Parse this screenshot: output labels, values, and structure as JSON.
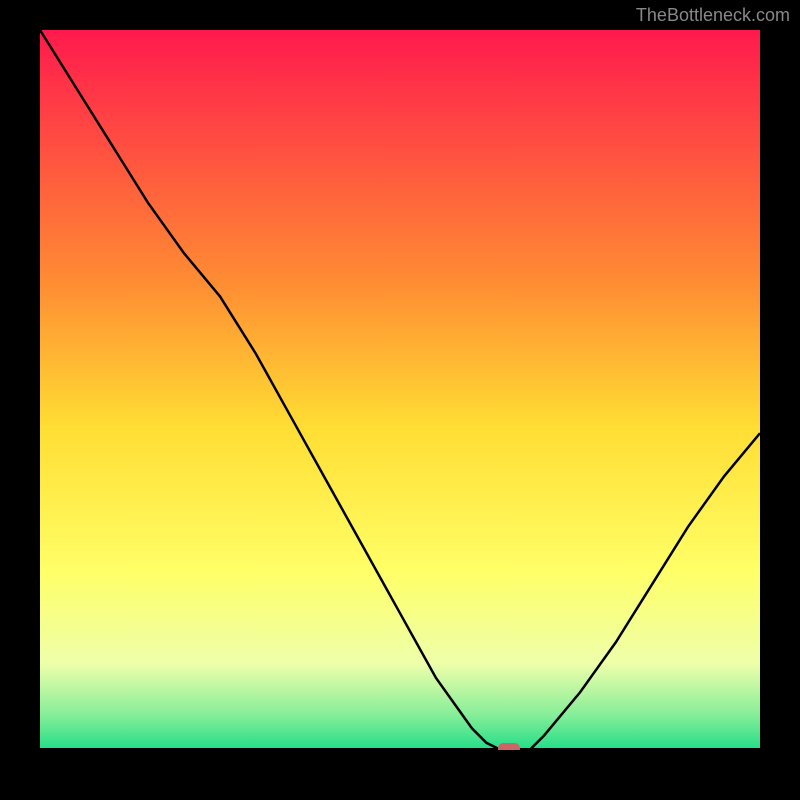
{
  "attribution": "TheBottleneck.com",
  "chart_data": {
    "type": "line",
    "title": "",
    "xlabel": "",
    "ylabel": "",
    "xlim": [
      0,
      100
    ],
    "ylim": [
      0,
      100
    ],
    "x": [
      0,
      5,
      10,
      15,
      20,
      25,
      30,
      35,
      40,
      45,
      50,
      55,
      60,
      62,
      64,
      66,
      68,
      70,
      75,
      80,
      85,
      90,
      95,
      100
    ],
    "values": [
      100,
      92,
      84,
      76,
      69,
      63,
      55,
      46,
      37,
      28,
      19,
      10,
      3,
      1,
      0,
      0,
      0,
      2,
      8,
      15,
      23,
      31,
      38,
      44
    ],
    "marker_position": {
      "x": 65,
      "y": 0
    },
    "background_gradient": {
      "type": "vertical",
      "stops": [
        {
          "pos": 0.0,
          "color": "#ff1a4d"
        },
        {
          "pos": 0.35,
          "color": "#ff8c33"
        },
        {
          "pos": 0.55,
          "color": "#ffdd33"
        },
        {
          "pos": 0.75,
          "color": "#ffff66"
        },
        {
          "pos": 0.88,
          "color": "#eeffaa"
        },
        {
          "pos": 0.95,
          "color": "#88ee99"
        },
        {
          "pos": 1.0,
          "color": "#22dd88"
        }
      ]
    }
  }
}
